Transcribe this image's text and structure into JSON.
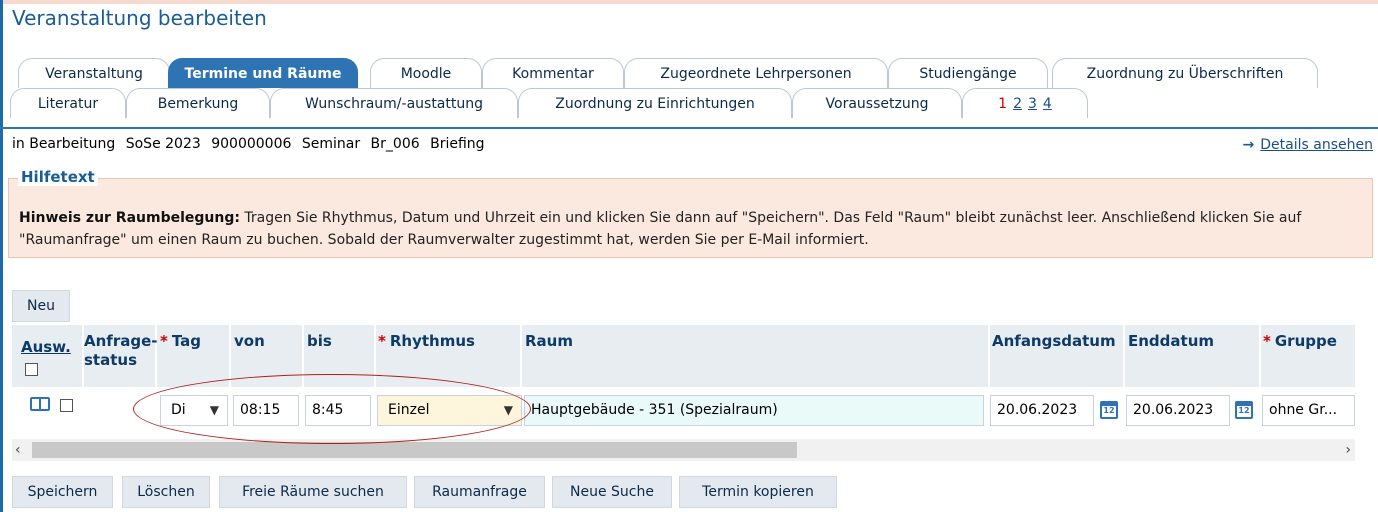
{
  "page_title": "Veranstaltung bearbeiten",
  "tabs_row1": [
    {
      "label": "Veranstaltung",
      "active": false
    },
    {
      "label": "Termine und Räume",
      "active": true
    },
    {
      "label": "Moodle",
      "active": false
    },
    {
      "label": "Kommentar",
      "active": false
    },
    {
      "label": "Zugeordnete Lehrpersonen",
      "active": false
    },
    {
      "label": "Studiengänge",
      "active": false
    },
    {
      "label": "Zuordnung zu Überschriften",
      "active": false
    }
  ],
  "tabs_row2": [
    {
      "label": "Literatur"
    },
    {
      "label": "Bemerkung"
    },
    {
      "label": "Wunschraum/-austattung"
    },
    {
      "label": "Zuordnung zu Einrichtungen"
    },
    {
      "label": "Voraussetzung"
    }
  ],
  "pagination": [
    "1",
    "2",
    "3",
    "4"
  ],
  "status": {
    "state": "in Bearbeitung",
    "semester": "SoSe 2023",
    "number": "900000006",
    "type": "Seminar",
    "code": "Br_006",
    "title": "Briefing"
  },
  "details_link": "Details ansehen",
  "help": {
    "legend": "Hilfetext",
    "bold": "Hinweis zur Raumbelegung:",
    "text": " Tragen Sie Rhythmus, Datum und Uhrzeit ein und klicken Sie dann auf \"Speichern\". Das Feld \"Raum\" bleibt zunächst leer. Anschließend klicken Sie auf \"Raumanfrage\" um einen Raum zu buchen. Sobald der Raumverwalter zugestimmt hat, werden Sie per E-Mail informiert."
  },
  "buttons": {
    "new": "Neu",
    "save": "Speichern",
    "delete": "Löschen",
    "free_rooms": "Freie Räume suchen",
    "room_request": "Raumanfrage",
    "new_search": "Neue Suche",
    "copy_date": "Termin kopieren"
  },
  "columns": {
    "select": "Ausw.",
    "request_status_1": "Anfrage-",
    "request_status_2": "status",
    "day": "Tag",
    "from": "von",
    "to": "bis",
    "rhythm": "Rhythmus",
    "room": "Raum",
    "start_date": "Anfangsdatum",
    "end_date": "Enddatum",
    "group": "Gruppe",
    "required_mark": "*"
  },
  "row": {
    "day": "Di",
    "from": "08:15",
    "to": "8:45",
    "rhythm": "Einzel",
    "room": "Hauptgebäude - 351 (Spezialraum)",
    "start_date": "20.06.2023",
    "end_date": "20.06.2023",
    "group": "ohne Gr..."
  },
  "icons": {
    "calendar_day": "12"
  },
  "colors": {
    "accent": "#2e74b5",
    "title": "#1a5d94",
    "help_bg": "#fbe9e0",
    "required": "#cc0000",
    "annotation": "#b02020"
  }
}
